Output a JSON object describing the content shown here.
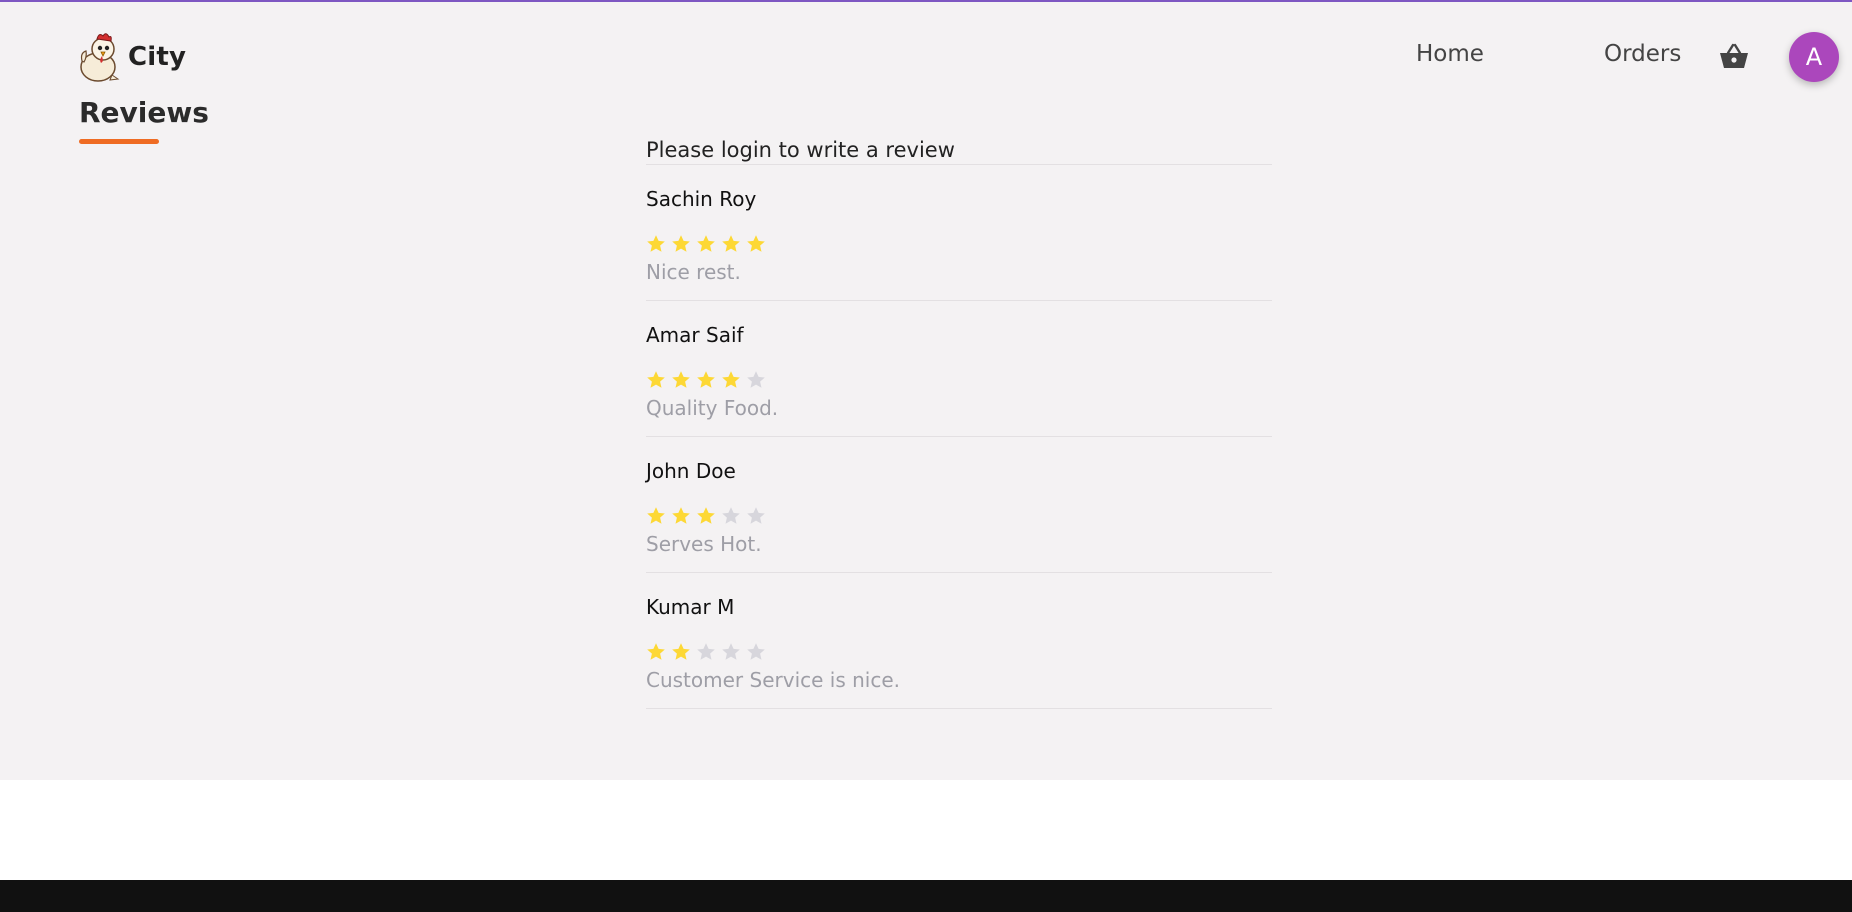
{
  "header": {
    "brand": "City",
    "nav": [
      {
        "label": "Home"
      },
      {
        "label": "Orders"
      }
    ],
    "avatar_initial": "A"
  },
  "reviews_section": {
    "title": "Reviews",
    "login_prompt": "Please login to write a review",
    "reviews": [
      {
        "name": "Sachin Roy",
        "rating": 5,
        "max_rating": 5,
        "text": "Nice rest."
      },
      {
        "name": "Amar Saif",
        "rating": 4,
        "max_rating": 5,
        "text": "Quality Food."
      },
      {
        "name": "John Doe",
        "rating": 3,
        "max_rating": 5,
        "text": "Serves Hot."
      },
      {
        "name": "Kumar M",
        "rating": 2,
        "max_rating": 5,
        "text": "Customer Service is nice."
      }
    ]
  },
  "colors": {
    "accent": "#7e57c2",
    "avatar": "#ab47bc",
    "underline": "#ef6c23",
    "star_filled": "#fdd835",
    "star_empty": "#d7d6dc",
    "footer": "#111111"
  },
  "icons": {
    "logo": "chicken-mascot-icon",
    "cart": "shopping-basket-icon",
    "star": "star-icon"
  }
}
